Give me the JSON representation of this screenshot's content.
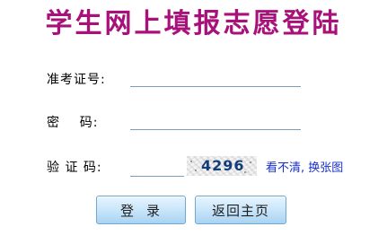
{
  "page": {
    "title": "学生网上填报志愿登陆"
  },
  "form": {
    "username_label": "准考证号:",
    "password_label": "密    码:",
    "captcha_label": "验 证 码:",
    "username_value": "",
    "password_value": "",
    "captcha_value": "",
    "captcha_code": "4296",
    "refresh_link": "看不清, 换张图"
  },
  "buttons": {
    "login": "登录",
    "back_home": "返回主页"
  },
  "colors": {
    "title": "#a8117a",
    "link": "#1a30c8",
    "button_border": "#6ea8d3",
    "input_underline": "#7f9db9"
  }
}
